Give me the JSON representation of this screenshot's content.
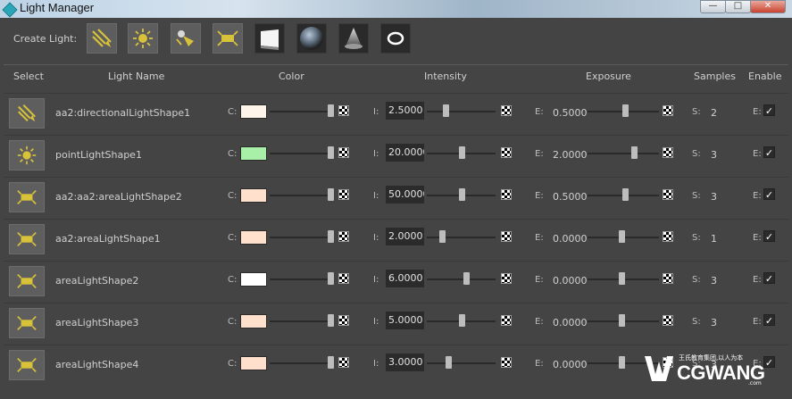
{
  "window": {
    "title": "Light Manager",
    "buttons": {
      "minimize": "—",
      "maximize": "□",
      "close": "✕"
    }
  },
  "toolbar": {
    "create_label": "Create Light:",
    "buttons": [
      {
        "icon": "directional-light-icon"
      },
      {
        "icon": "point-light-icon"
      },
      {
        "icon": "spot-light-icon"
      },
      {
        "icon": "area-light-icon"
      },
      {
        "icon": "ies-light-icon"
      },
      {
        "icon": "dome-light-icon"
      },
      {
        "icon": "volume-light-icon"
      },
      {
        "icon": "ring-light-icon"
      }
    ]
  },
  "headers": {
    "select": "Select",
    "name": "Light Name",
    "color": "Color",
    "intensity": "Intensity",
    "exposure": "Exposure",
    "samples": "Samples",
    "enable": "Enable"
  },
  "field_labels": {
    "color": "C:",
    "intensity": "I:",
    "exposure": "E:",
    "samples": "S:",
    "enable": "E:"
  },
  "lights": [
    {
      "icon": "directional-light-icon",
      "name": "aa2:directionalLightShape1",
      "color": "#fff4ea",
      "intensity": "2.5000",
      "intensity_slider": 0.27,
      "exposure": "0.5000",
      "exposure_slider": 0.52,
      "samples": "2",
      "enabled": "✓"
    },
    {
      "icon": "point-light-icon",
      "name": "pointLightShape1",
      "color": "#a8f0a8",
      "intensity": "20.0000",
      "intensity_slider": 0.5,
      "exposure": "2.0000",
      "exposure_slider": 0.65,
      "samples": "3",
      "enabled": "✓"
    },
    {
      "icon": "area-light-icon",
      "name": "aa2:aa2:areaLightShape2",
      "color": "#ffe0cc",
      "intensity": "50.0000",
      "intensity_slider": 0.5,
      "exposure": "0.5000",
      "exposure_slider": 0.52,
      "samples": "3",
      "enabled": "✓"
    },
    {
      "icon": "area-light-icon",
      "name": "aa2:areaLightShape1",
      "color": "#ffe0cc",
      "intensity": "2.0000",
      "intensity_slider": 0.22,
      "exposure": "0.0000",
      "exposure_slider": 0.47,
      "samples": "1",
      "enabled": "✓"
    },
    {
      "icon": "area-light-icon",
      "name": "areaLightShape2",
      "color": "#ffffff",
      "intensity": "6.0000",
      "intensity_slider": 0.57,
      "exposure": "0.0000",
      "exposure_slider": 0.47,
      "samples": "3",
      "enabled": "✓"
    },
    {
      "icon": "area-light-icon",
      "name": "areaLightShape3",
      "color": "#ffe0cc",
      "intensity": "5.0000",
      "intensity_slider": 0.5,
      "exposure": "0.0000",
      "exposure_slider": 0.47,
      "samples": "3",
      "enabled": "✓"
    },
    {
      "icon": "area-light-icon",
      "name": "areaLightShape4",
      "color": "#ffe0cc",
      "intensity": "3.0000",
      "intensity_slider": 0.31,
      "exposure": "0.0000",
      "exposure_slider": 0.47,
      "samples": "3",
      "enabled": "✓"
    }
  ],
  "watermark": {
    "brand": "CGWANG",
    "tagline": "王氏教育集团,以人为本",
    "domain": ".com"
  }
}
